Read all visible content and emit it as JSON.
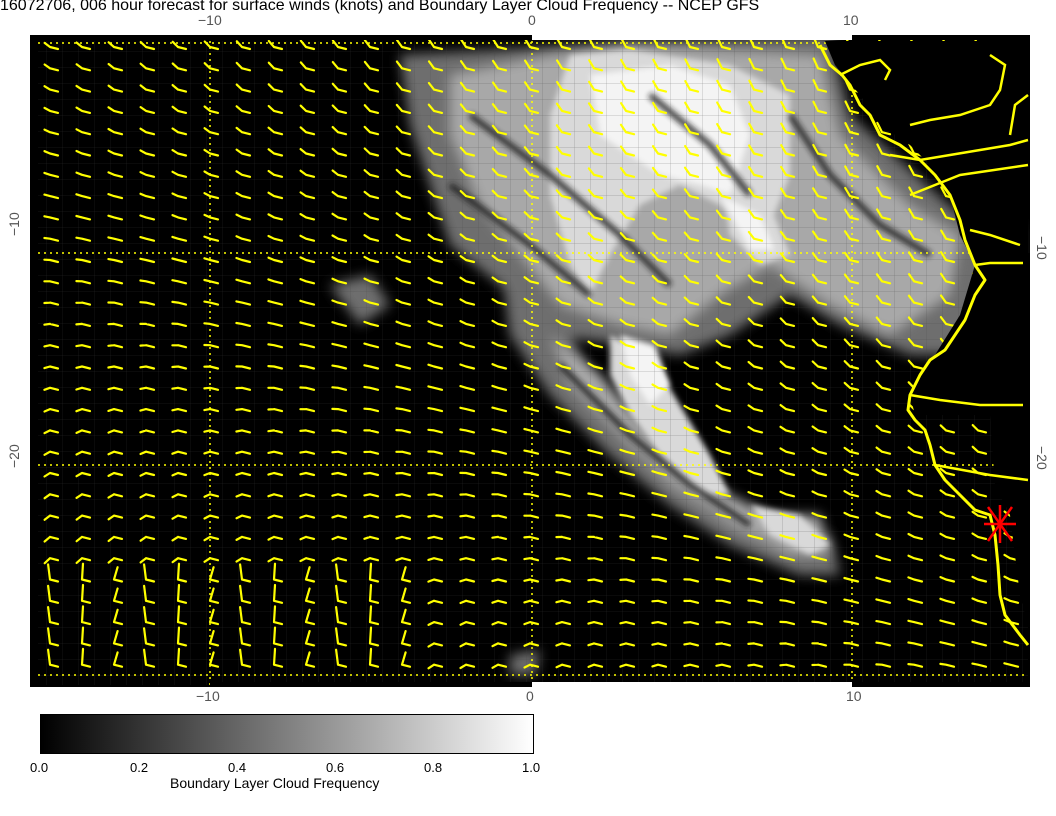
{
  "title": "16072706, 006 hour forecast for surface winds (knots) and Boundary Layer Cloud Frequency -- NCEP GFS",
  "axes": {
    "top_ticks": [
      "−10",
      "0",
      "10"
    ],
    "bottom_ticks": [
      "−10",
      "0",
      "10"
    ],
    "left_ticks": [
      "−10",
      "−20"
    ],
    "right_ticks": [
      "−10",
      "−20"
    ]
  },
  "colorbar": {
    "title": "Boundary Layer Cloud Frequency",
    "ticks": [
      "0.0",
      "0.2",
      "0.4",
      "0.6",
      "0.8",
      "1.0"
    ],
    "range": [
      0.0,
      1.0
    ]
  },
  "colors": {
    "background": "#000000",
    "wind_barbs": "#ffff00",
    "coastline": "#ffff00",
    "gridlines": "#ffff00",
    "marker": "#ff0000",
    "cloud_max": "#ffffff"
  },
  "map": {
    "lon_range": [
      -15,
      15
    ],
    "lat_range": [
      -30,
      0
    ],
    "marker_label": "red-star-marker"
  }
}
